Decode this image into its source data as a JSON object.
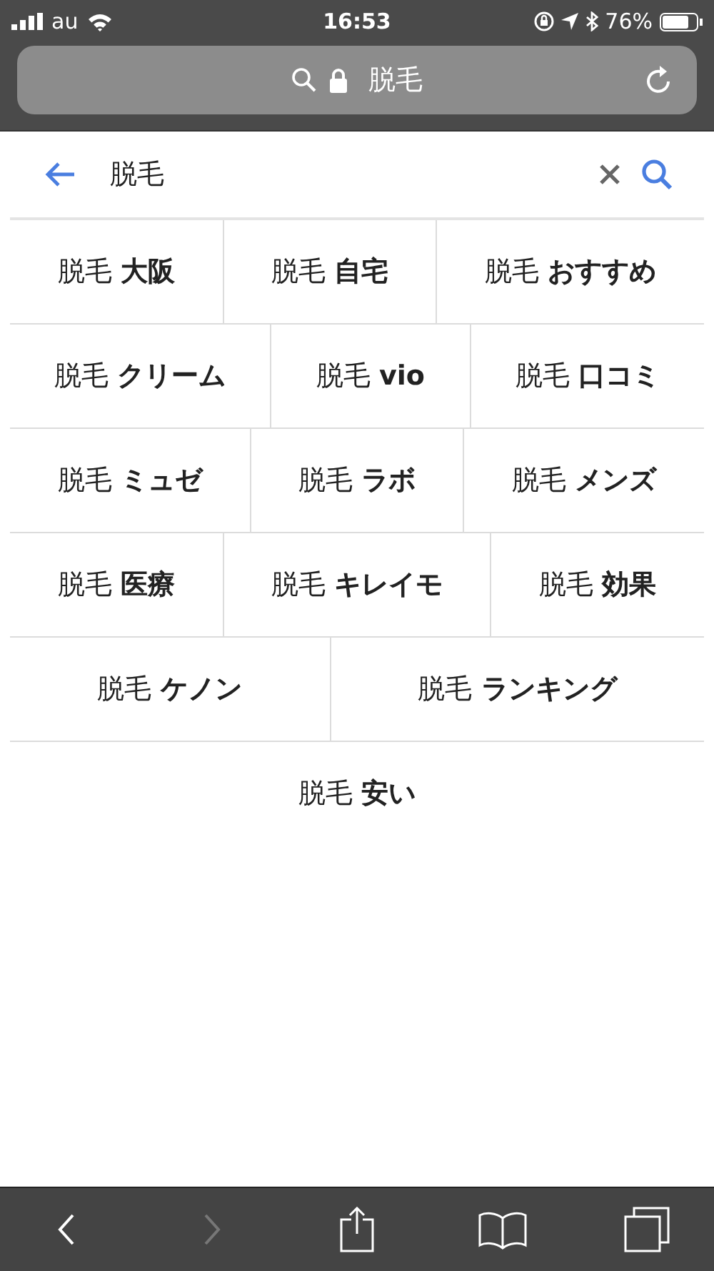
{
  "status_bar": {
    "carrier": "au",
    "time": "16:53",
    "battery": "76%"
  },
  "address_bar": {
    "text": "脱毛"
  },
  "search": {
    "value": "脱毛"
  },
  "suggestions": [
    [
      "脱毛 **大阪**",
      "脱毛 **自宅**",
      "脱毛 **おすすめ**"
    ],
    [
      "脱毛 **クリーム**",
      "脱毛 **vio**",
      "脱毛 **口コミ**"
    ],
    [
      "脱毛 **ミュゼ**",
      "脱毛 **ラボ**",
      "脱毛 **メンズ**"
    ],
    [
      "脱毛 **医療**",
      "脱毛 **キレイモ**",
      "脱毛 **効果**"
    ],
    [
      "脱毛 **ケノン**",
      "脱毛 **ランキング**"
    ],
    [
      "脱毛 **安い**"
    ]
  ],
  "toolbar": [
    {
      "kind": "back",
      "disabled": false
    },
    {
      "kind": "forward",
      "disabled": true
    },
    {
      "kind": "share",
      "disabled": false
    },
    {
      "kind": "bookmarks",
      "disabled": false
    },
    {
      "kind": "tabs",
      "disabled": false
    }
  ]
}
